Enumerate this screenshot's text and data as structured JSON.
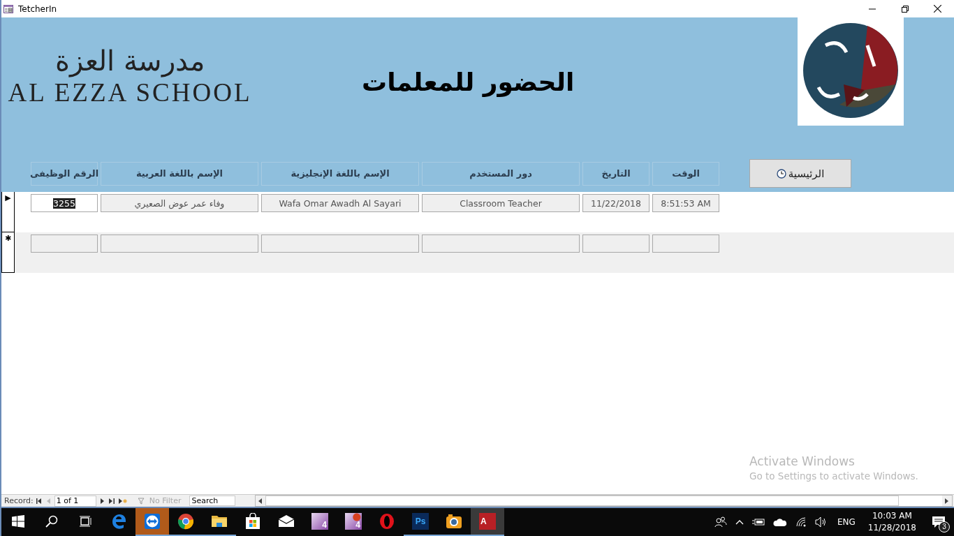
{
  "window": {
    "title": "TetcherIn"
  },
  "header": {
    "school_name_arabic": "مدرسة العزة",
    "school_name_english": "AL EZZA SCHOOL",
    "title": "الحضور للمعلمات",
    "home_button": "الرئيسية"
  },
  "table": {
    "columns": [
      "الوقت",
      "التاريخ",
      "دور المستخدم",
      "الإسم باللغة الإنجليزية",
      "الإسم باللغة العربية",
      "الرقم الوظيفى"
    ],
    "rows": [
      {
        "kind": "current",
        "marker": "▶",
        "cells": [
          {
            "value": "8:51:53 AM",
            "selected": false
          },
          {
            "value": "11/22/2018",
            "selected": false
          },
          {
            "value": "Classroom Teacher",
            "selected": false
          },
          {
            "value": "Wafa Omar Awadh Al Sayari",
            "selected": false
          },
          {
            "value": "وفاء عمر عوض الصعيري",
            "selected": false
          },
          {
            "value": "3255",
            "selected": true
          }
        ]
      },
      {
        "kind": "new",
        "marker": "✱"
      }
    ]
  },
  "navigation": {
    "label": "Record:",
    "position": "1 of 1",
    "filter": "No Filter",
    "filter_disabled": true,
    "search_placeholder": "Search"
  },
  "activation_notice": {
    "title": "Activate Windows",
    "text": "Go to Settings to activate Windows."
  },
  "taskbar": {
    "apps": [
      {
        "kind": "access",
        "label": "A",
        "running": true,
        "active": true
      },
      {
        "kind": "camera",
        "running": true,
        "active": false
      },
      {
        "kind": "ps",
        "label": "Ps",
        "running": true,
        "active": false
      },
      {
        "kind": "opera",
        "running": false,
        "active": false
      },
      {
        "kind": "recorder",
        "label": "4",
        "running": false,
        "active": false
      },
      {
        "kind": "notebook",
        "label": "4",
        "running": false,
        "active": false
      },
      {
        "kind": "mail",
        "running": false,
        "active": false
      },
      {
        "kind": "store",
        "running": false,
        "active": false
      },
      {
        "kind": "folder",
        "running": true,
        "active": false
      },
      {
        "kind": "chrome",
        "running": true,
        "active": false
      },
      {
        "kind": "remote",
        "running": true,
        "active": true
      },
      {
        "kind": "edge",
        "running": false,
        "active": false
      }
    ],
    "tray": {
      "language": "ENG",
      "time": "10:03 AM",
      "date": "11/28/2018",
      "notifications": "3"
    }
  }
}
